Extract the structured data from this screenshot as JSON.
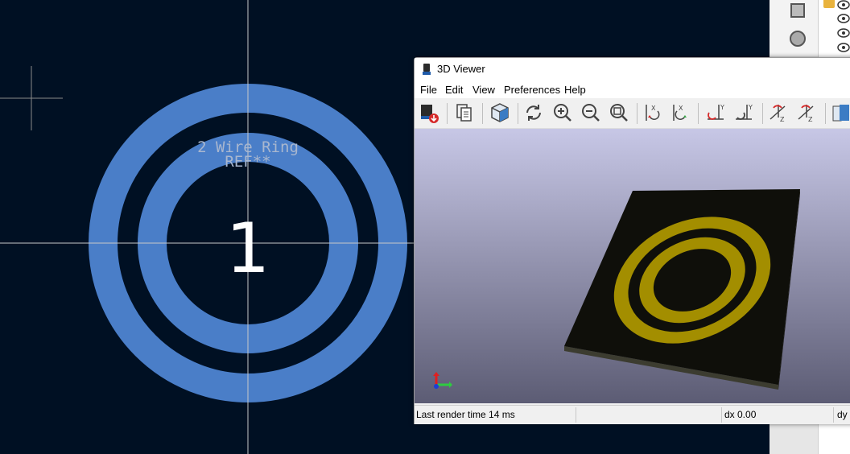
{
  "pcb_editor": {
    "footprint_value": "2 Wire Ring",
    "reference": "REF**",
    "pad_number": "1",
    "ring_color": "#4a7ec8",
    "background_color": "#001023",
    "crosshair_color": "#c8c8c8"
  },
  "right_panel": {
    "tools": [
      "rectangle-tool-icon",
      "circle-tool-icon"
    ],
    "layer_visibility_icons": [
      "eye-icon",
      "eye-icon",
      "eye-icon",
      "eye-icon"
    ]
  },
  "viewer": {
    "title": "3D Viewer",
    "menu": [
      "File",
      "Edit",
      "View",
      "Preferences",
      "Help"
    ],
    "toolbar_icons": [
      "export-image-icon",
      "copy-image-icon",
      "raytrace-view-icon",
      "reload-icon",
      "zoom-in-icon",
      "zoom-out-icon",
      "zoom-fit-icon",
      "rotate-x-cw-icon",
      "rotate-x-ccw-icon",
      "rotate-y-cw-icon",
      "rotate-y-ccw-icon",
      "rotate-z-cw-icon",
      "rotate-z-ccw-icon",
      "flip-board-icon"
    ],
    "board_color": "#0f0f0a",
    "copper_color": "#a38e00",
    "status": {
      "render_time": "Last render time 14 ms",
      "dx": "dx 0.00",
      "dy": "dy"
    }
  }
}
